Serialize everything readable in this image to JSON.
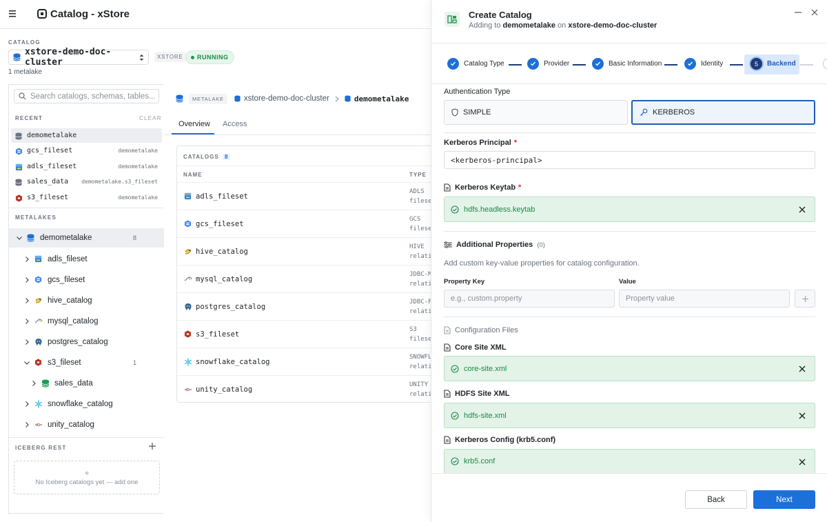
{
  "app": {
    "title": "Catalog - xStore"
  },
  "catalog_bar": {
    "caption": "CATALOG",
    "cluster": "xstore-demo-doc-cluster",
    "type_badge": "XSTORE",
    "status": "RUNNING",
    "metalake_count": "1 metalake"
  },
  "sidebar": {
    "search_placeholder": "Search catalogs, schemas, tables...",
    "recent_label": "RECENT",
    "clear_label": "CLEAR",
    "recent": [
      {
        "name": "demometalake",
        "meta": "",
        "icon": "database-icon"
      },
      {
        "name": "gcs_fileset",
        "meta": "demometalake",
        "icon": "gcs-icon"
      },
      {
        "name": "adls_fileset",
        "meta": "demometalake",
        "icon": "adls-icon"
      },
      {
        "name": "sales_data",
        "meta": "demometalake.s3_fileset",
        "icon": "database-icon"
      },
      {
        "name": "s3_fileset",
        "meta": "demometalake",
        "icon": "s3-icon"
      }
    ],
    "metalakes_label": "METALAKES",
    "tree": [
      {
        "name": "demometalake",
        "count": "8",
        "icon": "database-icon",
        "expanded": true
      },
      {
        "name": "adls_fileset",
        "count": "",
        "icon": "adls-icon"
      },
      {
        "name": "gcs_fileset",
        "count": "",
        "icon": "gcs-icon"
      },
      {
        "name": "hive_catalog",
        "count": "",
        "icon": "hive-icon"
      },
      {
        "name": "mysql_catalog",
        "count": "",
        "icon": "mysql-icon"
      },
      {
        "name": "postgres_catalog",
        "count": "",
        "icon": "postgres-icon"
      },
      {
        "name": "s3_fileset",
        "count": "1",
        "icon": "s3-icon",
        "expanded": true
      },
      {
        "name": "sales_data",
        "count": "",
        "icon": "schema-icon"
      },
      {
        "name": "snowflake_catalog",
        "count": "",
        "icon": "snowflake-icon"
      },
      {
        "name": "unity_catalog",
        "count": "",
        "icon": "unity-icon"
      }
    ],
    "iceberg_label": "ICEBERG REST",
    "iceberg_empty": "No Iceberg catalogs yet — add one"
  },
  "main": {
    "breadcrumb": {
      "badge": "METALAKE",
      "cluster": "xstore-demo-doc-cluster",
      "current": "demometalake"
    },
    "tabs": [
      "Overview",
      "Access"
    ],
    "table": {
      "title": "CATALOGS",
      "count": "8",
      "col_name": "NAME",
      "col_type": "TYPE",
      "rows": [
        {
          "name": "adls_fileset",
          "type1": "ADLS",
          "type2": "fileset",
          "icon": "adls-icon"
        },
        {
          "name": "gcs_fileset",
          "type1": "GCS",
          "type2": "fileset",
          "icon": "gcs-icon"
        },
        {
          "name": "hive_catalog",
          "type1": "HIVE",
          "type2": "relational",
          "icon": "hive-icon"
        },
        {
          "name": "mysql_catalog",
          "type1": "JDBC-MYSQL",
          "type2": "relational",
          "icon": "mysql-icon"
        },
        {
          "name": "postgres_catalog",
          "type1": "JDBC-POSTGRESQL",
          "type2": "relational",
          "icon": "postgres-icon"
        },
        {
          "name": "s3_fileset",
          "type1": "S3",
          "type2": "fileset",
          "icon": "s3-icon"
        },
        {
          "name": "snowflake_catalog",
          "type1": "SNOWFLAKE",
          "type2": "relational",
          "icon": "snowflake-icon"
        },
        {
          "name": "unity_catalog",
          "type1": "UNITY",
          "type2": "relational",
          "icon": "unity-icon"
        }
      ]
    }
  },
  "dialog": {
    "title": "Create Catalog",
    "subtitle_prefix": "Adding to",
    "subtitle_metalake": "demometalake",
    "subtitle_on": "on",
    "subtitle_cluster": "xstore-demo-doc-cluster",
    "steps": [
      {
        "label": "Catalog Type",
        "state": "done"
      },
      {
        "label": "Provider",
        "state": "done"
      },
      {
        "label": "Basic Information",
        "state": "done"
      },
      {
        "label": "Identity",
        "state": "done"
      },
      {
        "label": "Backend",
        "number": "5",
        "state": "active"
      },
      {
        "label": "",
        "number": "6",
        "state": "pending"
      }
    ],
    "auth_type_label": "Authentication Type",
    "auth_options": [
      "SIMPLE",
      "KERBEROS"
    ],
    "auth_selected": "KERBEROS",
    "principal_label": "Kerberos Principal",
    "principal_value": "<kerberos-principal>",
    "keytab_label": "Kerberos Keytab",
    "keytab_file": "hdfs.headless.keytab",
    "additional_label": "Additional Properties",
    "additional_count": "(0)",
    "additional_desc": "Add custom key-value properties for catalog configuration.",
    "prop_key_label": "Property Key",
    "prop_key_placeholder": "e.g., custom.property",
    "prop_value_label": "Value",
    "prop_value_placeholder": "Property value",
    "config_files_label": "Configuration Files",
    "core_site_label": "Core Site XML",
    "core_site_file": "core-site.xml",
    "hdfs_site_label": "HDFS Site XML",
    "hdfs_site_file": "hdfs-site.xml",
    "krb5_label": "Kerberos Config (krb5.conf)",
    "krb5_file": "krb5.conf",
    "back_label": "Back",
    "next_label": "Next",
    "accent": "#1d6fd9",
    "success_bg": "#e3f3e8"
  }
}
